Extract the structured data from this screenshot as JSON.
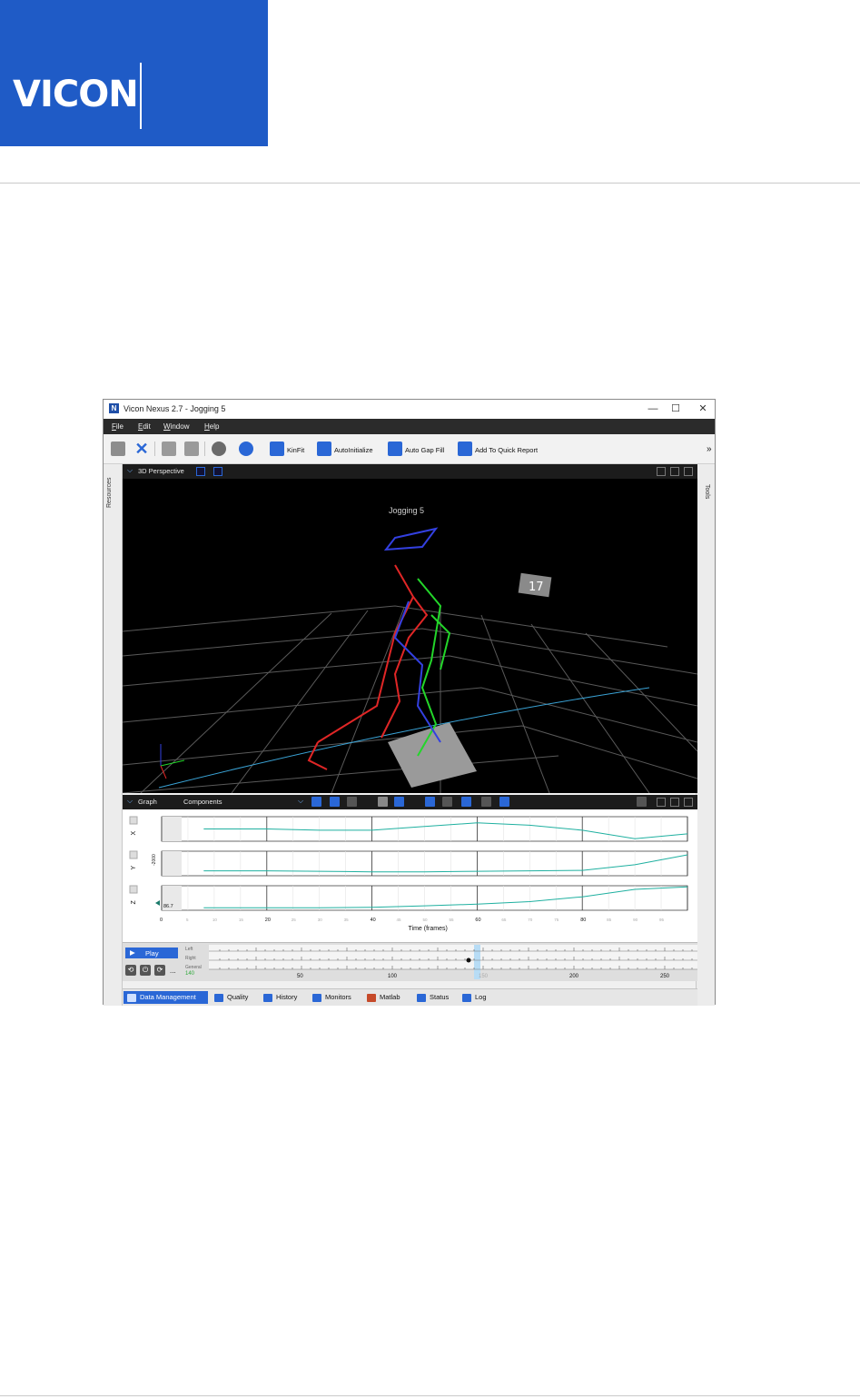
{
  "logo": {
    "text": "VICON"
  },
  "window": {
    "title": "Vicon Nexus 2.7 - Jogging 5",
    "icon_letter": "N",
    "controls": {
      "minimize": "—",
      "maximize": "☐",
      "close": "✕"
    }
  },
  "menu": [
    "File",
    "Edit",
    "Window",
    "Help"
  ],
  "toolbar": {
    "kinfit": "KinFit",
    "autoinitialize": "AutoInitialize",
    "auto_gap_fill": "Auto Gap Fill",
    "add_quick_report": "Add To Quick Report",
    "overflow": "»"
  },
  "side": {
    "left": "Resources",
    "right": "Tools"
  },
  "view3d": {
    "title": "3D Perspective",
    "trial_label": "Jogging 5",
    "marker_label": "17"
  },
  "graph": {
    "title": "Graph",
    "mode": "Components",
    "axes": [
      "X",
      "Y",
      "Z"
    ],
    "y_tick": "-2000",
    "z_value": "86.7",
    "xlabel": "Time (frames)",
    "xticks_major": [
      "0",
      "20",
      "40",
      "60",
      "80"
    ],
    "xticks_minor": [
      "5",
      "10",
      "15",
      "25",
      "30",
      "35",
      "45",
      "50",
      "55",
      "65",
      "70",
      "75",
      "85",
      "90",
      "95"
    ]
  },
  "chart_data": {
    "type": "line",
    "xlabel": "Time (frames)",
    "xlim": [
      0,
      100
    ],
    "series": [
      {
        "x": [
          8,
          20,
          30,
          40,
          50,
          60,
          70,
          80,
          90,
          100
        ],
        "values": [
          0.5,
          0.5,
          0.45,
          0.45,
          0.6,
          0.75,
          0.65,
          0.45,
          0.1,
          0.3
        ]
      },
      {
        "x": [
          8,
          20,
          30,
          40,
          50,
          60,
          70,
          80,
          90,
          100
        ],
        "values": [
          0.2,
          0.2,
          0.18,
          0.16,
          0.16,
          0.18,
          0.2,
          0.22,
          0.45,
          0.85
        ]
      },
      {
        "x": [
          8,
          20,
          30,
          40,
          50,
          60,
          70,
          80,
          90,
          100
        ],
        "values": [
          0.1,
          0.1,
          0.1,
          0.12,
          0.18,
          0.25,
          0.35,
          0.55,
          0.85,
          0.95
        ]
      }
    ]
  },
  "timebar": {
    "play": "Play",
    "tracks": [
      "Left",
      "Right",
      "General"
    ],
    "current_frame": "140",
    "ticks": [
      "50",
      "100",
      "150",
      "200",
      "250"
    ],
    "small_buttons": [
      "⟲",
      "⏻",
      "⟳",
      "..."
    ]
  },
  "tabs": [
    "Data Management",
    "Quality",
    "History",
    "Monitors",
    "Matlab",
    "Status",
    "Log"
  ]
}
